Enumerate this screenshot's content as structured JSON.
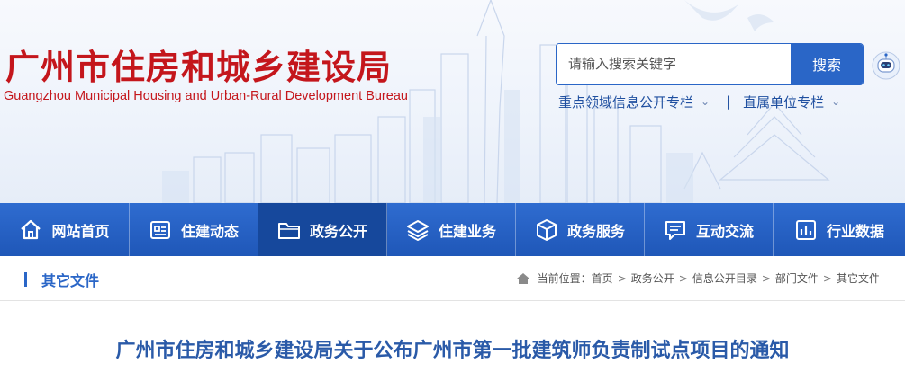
{
  "header": {
    "site_title": "广州市住房和城乡建设局",
    "site_subtitle": "Guangzhou Municipal Housing and Urban-Rural Development Bureau",
    "brand_color": "#c4161c"
  },
  "search": {
    "placeholder": "请输入搜索关键字",
    "value": "",
    "button_label": "搜索"
  },
  "quick_links": [
    {
      "label": "重点领域信息公开专栏",
      "icon": "chevron-down-icon"
    },
    {
      "label": "直属单位专栏",
      "icon": "chevron-down-icon"
    }
  ],
  "quick_links_separator": "|",
  "nav": {
    "accent": "#1f57b8",
    "items": [
      {
        "label": "网站首页",
        "icon": "home-icon"
      },
      {
        "label": "住建动态",
        "icon": "news-icon"
      },
      {
        "label": "政务公开",
        "icon": "folder-icon",
        "active": true
      },
      {
        "label": "住建业务",
        "icon": "layers-icon"
      },
      {
        "label": "政务服务",
        "icon": "cube-icon"
      },
      {
        "label": "互动交流",
        "icon": "chat-icon"
      },
      {
        "label": "行业数据",
        "icon": "chart-icon"
      }
    ]
  },
  "section": {
    "title": "其它文件"
  },
  "breadcrumb": {
    "prefix": "当前位置：",
    "separator": ">",
    "items": [
      "首页",
      "政务公开",
      "信息公开目录",
      "部门文件",
      "其它文件"
    ]
  },
  "article": {
    "title": "广州市住房和城乡建设局关于公布广州市第一批建筑师负责制试点项目的通知",
    "title_color": "#2a5aa8"
  }
}
